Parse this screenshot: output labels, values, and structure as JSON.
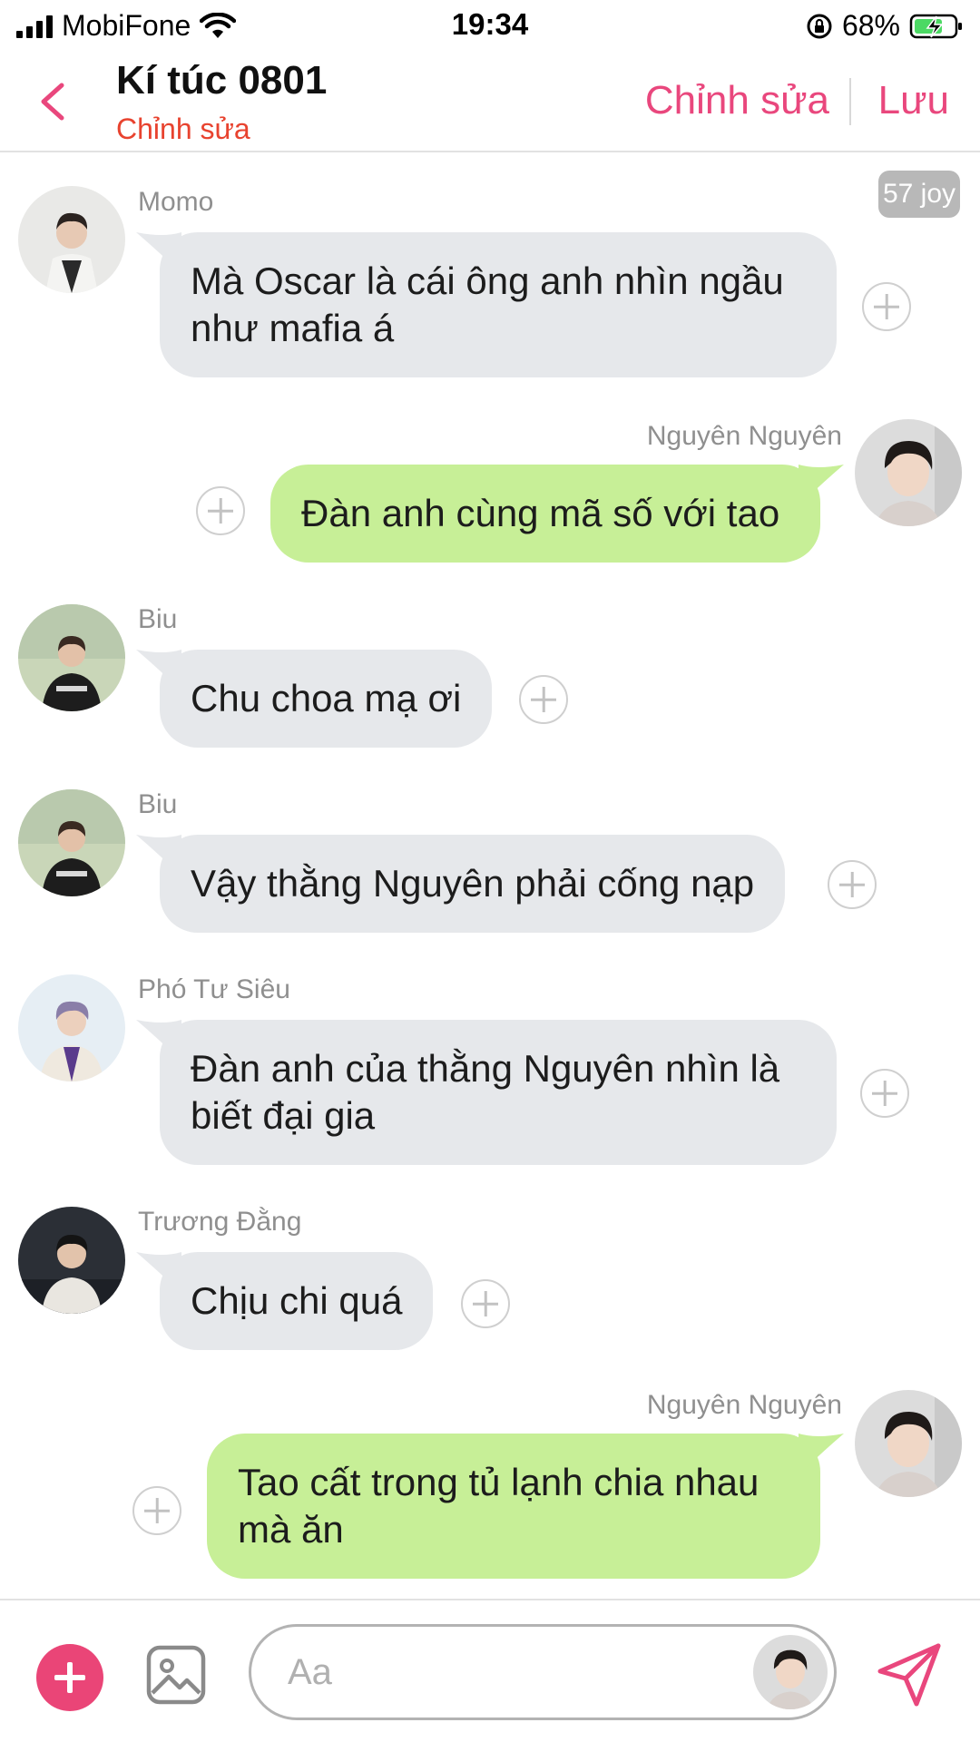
{
  "status_bar": {
    "carrier": "MobiFone",
    "time": "19:34",
    "battery": "68%"
  },
  "header": {
    "title": "Kí túc 0801",
    "subtitle": "Chỉnh sửa",
    "edit_label": "Chỉnh sửa",
    "save_label": "Lưu",
    "accent_color": "#e9477d",
    "subtitle_color": "#e8432f"
  },
  "badge": {
    "joy": "57 joy"
  },
  "messages": [
    {
      "sender": "Momo",
      "side": "left",
      "text": "Mà Oscar là cái ông anh nhìn ngầu như mafia á"
    },
    {
      "sender": "Nguyên Nguyên",
      "side": "right",
      "text": "Đàn anh cùng mã số với tao"
    },
    {
      "sender": "Biu",
      "side": "left",
      "text": "Chu choa mạ ơi"
    },
    {
      "sender": "Biu",
      "side": "left",
      "text": "Vậy thằng Nguyên phải cống nạp"
    },
    {
      "sender": "Phó Tư Siêu",
      "side": "left",
      "text": "Đàn anh của thằng Nguyên nhìn là biết đại gia"
    },
    {
      "sender": "Trương Đằng",
      "side": "left",
      "text": "Chịu chi quá"
    },
    {
      "sender": "Nguyên Nguyên",
      "side": "right",
      "text": "Tao cất trong tủ lạnh chia nhau mà ăn"
    }
  ],
  "input": {
    "placeholder": "Aa"
  },
  "colors": {
    "left_bubble": "#e6e8eb",
    "right_bubble": "#c7ef97",
    "add_button": "#ea4577"
  }
}
